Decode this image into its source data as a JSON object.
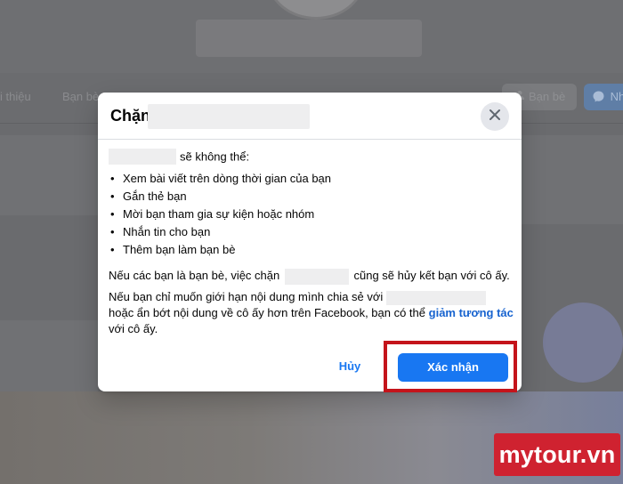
{
  "background": {
    "nav_tabs": [
      "i thiệu",
      "Bạn bè"
    ],
    "friends_button_label": "Bạn bè",
    "message_button_label": "Nh"
  },
  "dialog": {
    "title": "Chặn",
    "intro_suffix": "sẽ không thể:",
    "bullets": [
      "Xem bài viết trên dòng thời gian của bạn",
      "Gắn thẻ bạn",
      "Mời bạn tham gia sự kiện hoặc nhóm",
      "Nhắn tin cho bạn",
      "Thêm bạn làm bạn bè"
    ],
    "para1_before": "Nếu các bạn là bạn bè, việc chặn",
    "para1_after": "cũng sẽ hủy kết bạn với cô ấy.",
    "para2_before": "Nếu bạn chỉ muốn giới hạn nội dung mình chia sẻ với",
    "para2_middle": "hoặc ẩn bớt nội dung về cô ấy hơn trên Facebook, bạn có thể",
    "para2_link": "giảm tương tác",
    "para2_after": "với cô ấy.",
    "cancel_label": "Hủy",
    "confirm_label": "Xác nhận"
  },
  "watermark": "mytour.vn",
  "colors": {
    "primary": "#1877f2",
    "link": "#1763cf",
    "highlight": "#c4141b",
    "watermark_bg": "#cf2230"
  },
  "icons": {
    "close": "close-icon",
    "friends": "friends-icon",
    "messenger": "messenger-icon"
  }
}
